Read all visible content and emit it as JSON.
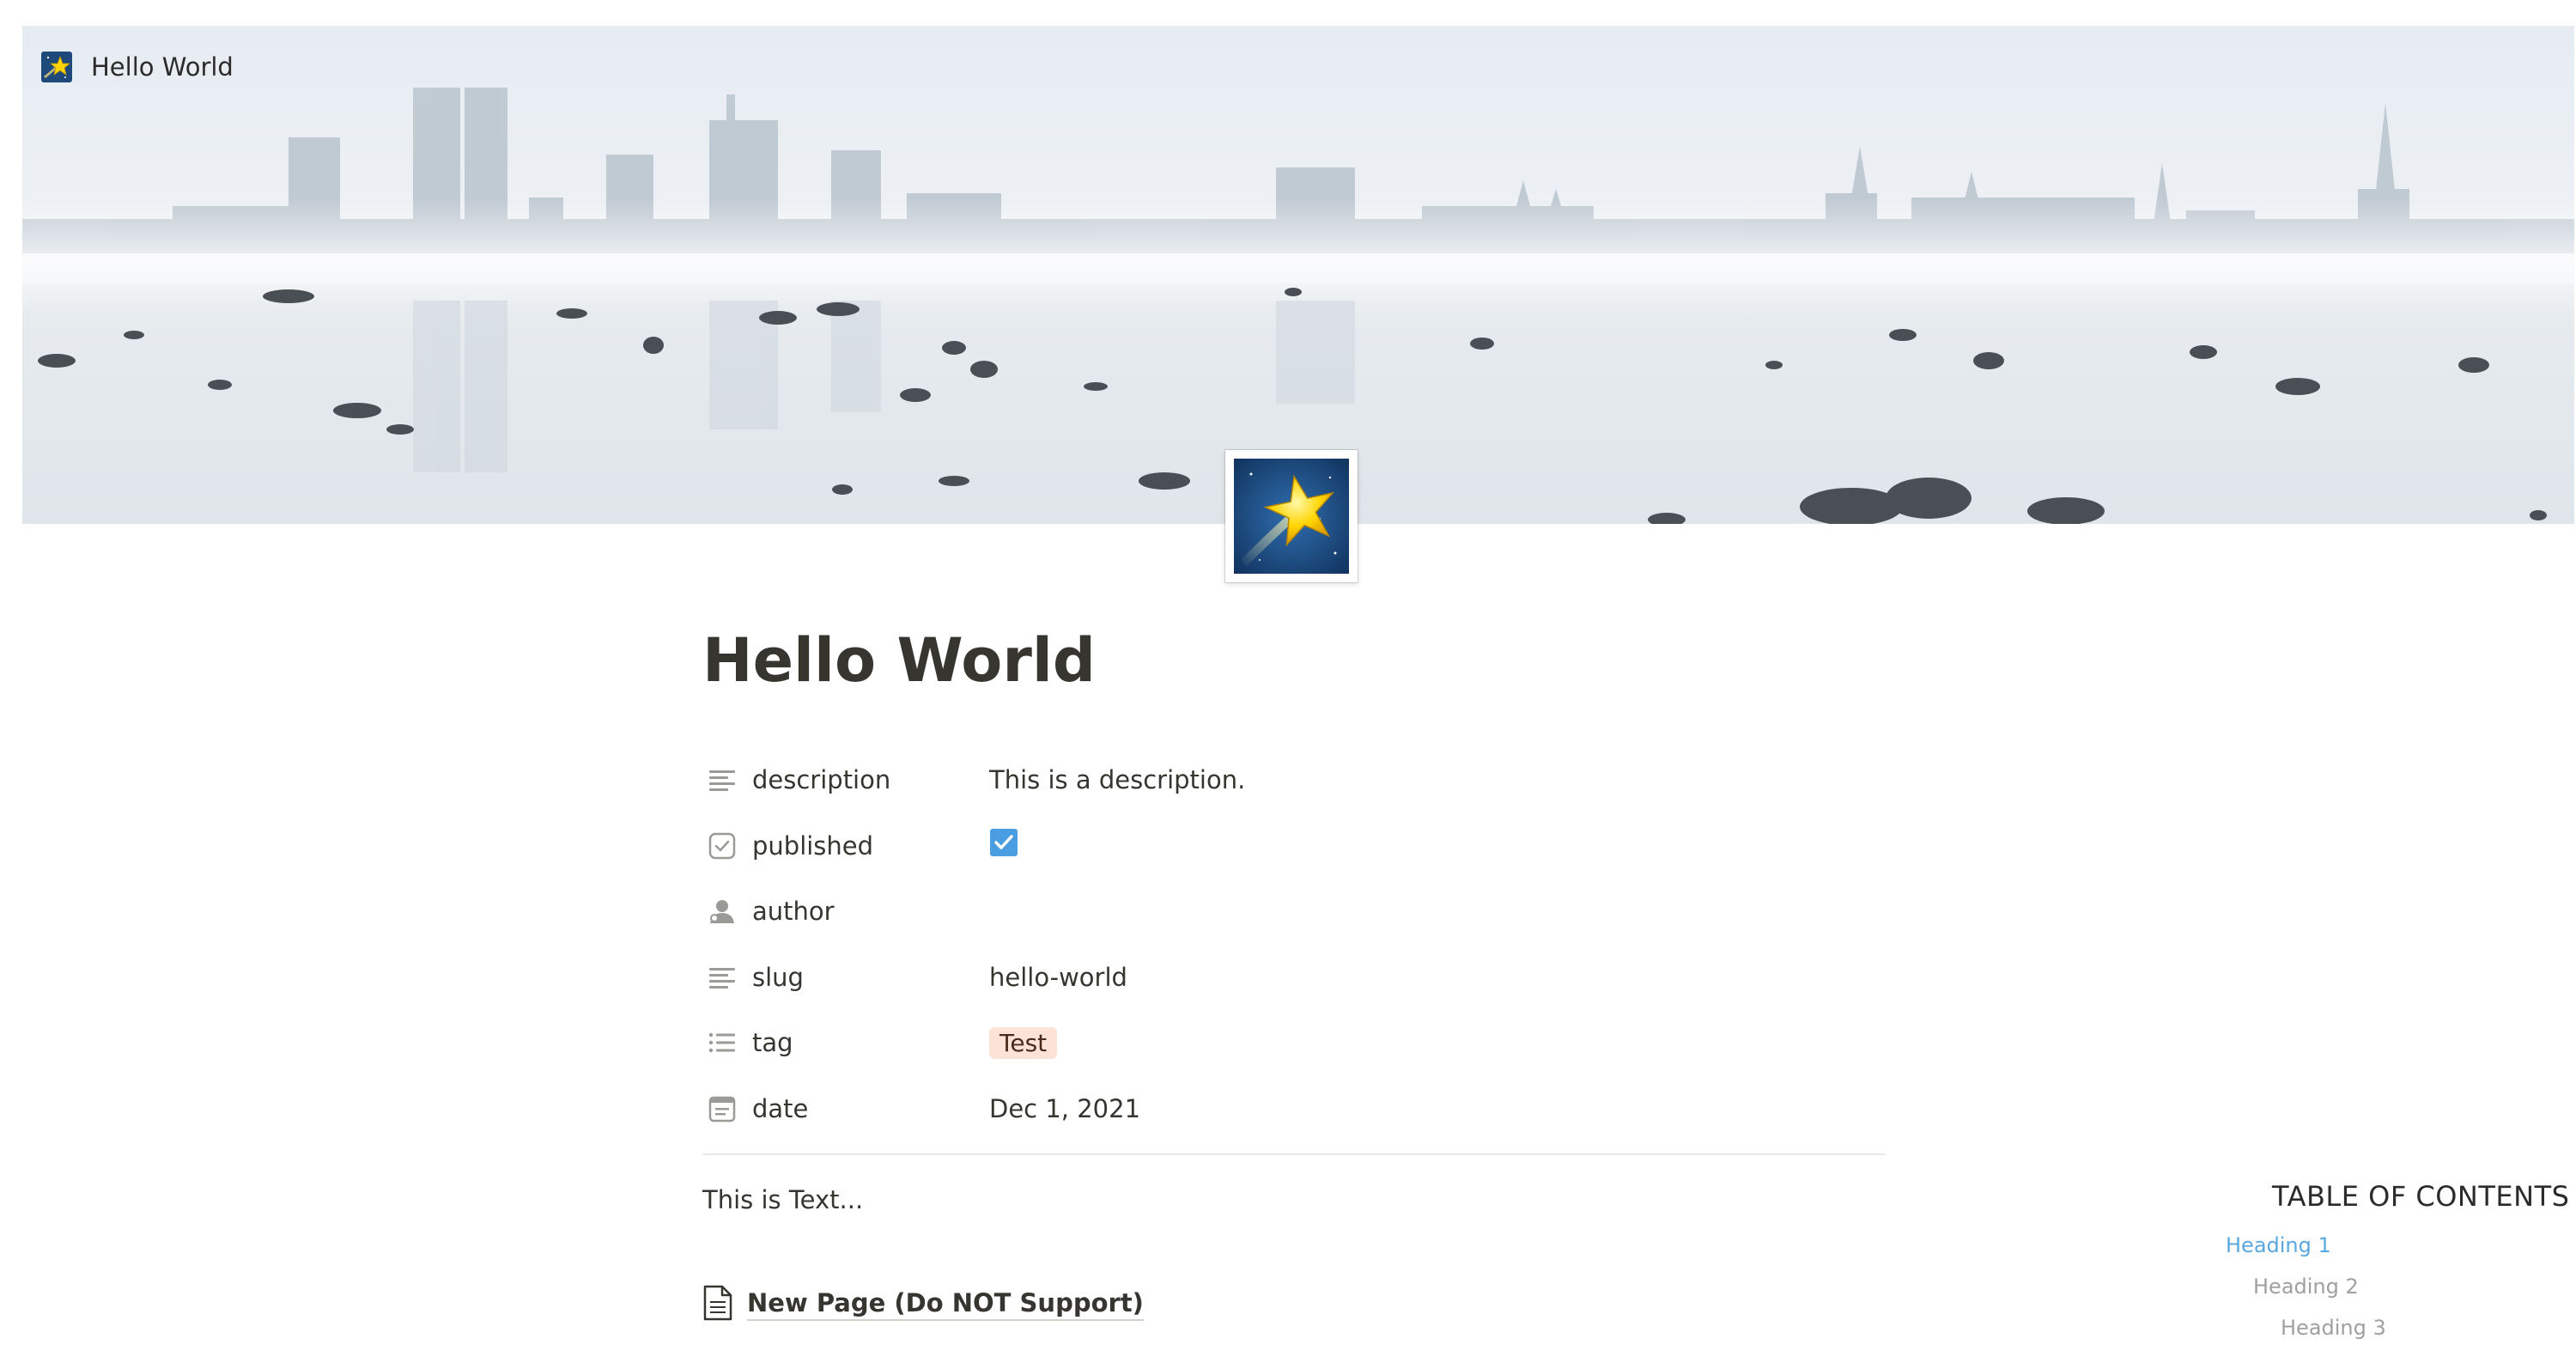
{
  "topbar": {
    "title": "Hello World",
    "icon": "star-emoji-icon"
  },
  "cover": {
    "description_icon": "misty-city-skyline-cover-image"
  },
  "page": {
    "icon": "shooting-star-icon",
    "title": "Hello World"
  },
  "properties": [
    {
      "name": "description",
      "icon": "text-lines-icon",
      "value": "This is a description."
    },
    {
      "name": "published",
      "icon": "checkbox-icon",
      "value_checked": true
    },
    {
      "name": "author",
      "icon": "person-icon",
      "value": ""
    },
    {
      "name": "slug",
      "icon": "text-lines-icon",
      "value": "hello-world"
    },
    {
      "name": "tag",
      "icon": "list-icon",
      "value": "Test"
    },
    {
      "name": "date",
      "icon": "calendar-icon",
      "value": "Dec 1, 2021"
    }
  ],
  "content": {
    "text": "This is Text...",
    "subpage_label": "New Page (Do NOT Support)",
    "subpage_icon": "document-icon"
  },
  "toc": {
    "title": "TABLE OF CONTENTS",
    "items": [
      "Heading 1",
      "Heading 2",
      "Heading 3"
    ]
  },
  "colors": {
    "text": "#37352f",
    "tag_bg": "#fbe4d7",
    "checkbox": "#4a9de0",
    "toc_active": "#5aa8e0",
    "toc_inactive": "#a0a0a0"
  }
}
